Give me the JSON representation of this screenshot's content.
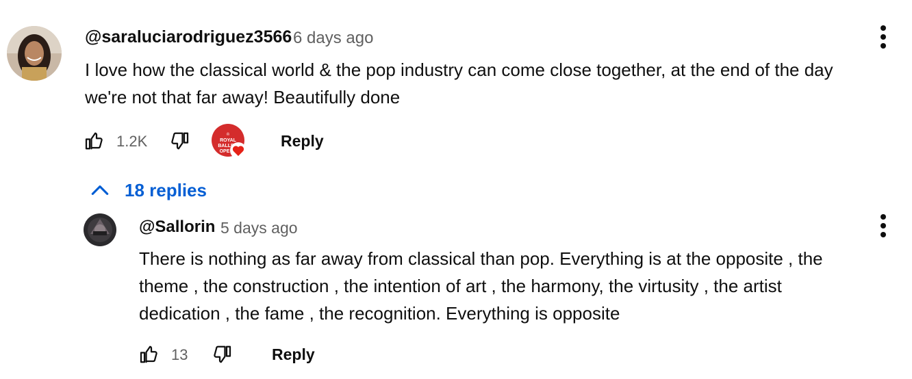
{
  "top_comment": {
    "author": "@saraluciarodriguez3566",
    "time": "6 days ago",
    "text_line1": "I love how the classical world & the pop industry can come close together, at the end of the day",
    "text_line2": "we're not that far away! Beautifully done",
    "likes": "1.2K",
    "reply_label": "Reply",
    "creator_heart_text": "ROYAL BALLET OPERA"
  },
  "replies_toggle": {
    "label": "18 replies"
  },
  "reply_comment": {
    "author": "@Sallorin",
    "time": "5 days ago",
    "text_line1": "There is nothing as far away from classical than pop. Everything is at the opposite , the",
    "text_line2": "theme , the construction , the intention of art , the harmony, the virtusity , the artist",
    "text_line3": "dedication , the fame , the recognition. Everything is opposite",
    "likes": "13",
    "reply_label": "Reply"
  },
  "colors": {
    "link_blue": "#065fd4",
    "secondary_text": "#606060",
    "heart_red": "#e62117",
    "badge_red": "#d42c2c"
  },
  "icons": [
    "more-vert-icon",
    "thumb-up-icon",
    "thumb-down-icon",
    "chevron-up-icon",
    "heart-icon"
  ]
}
